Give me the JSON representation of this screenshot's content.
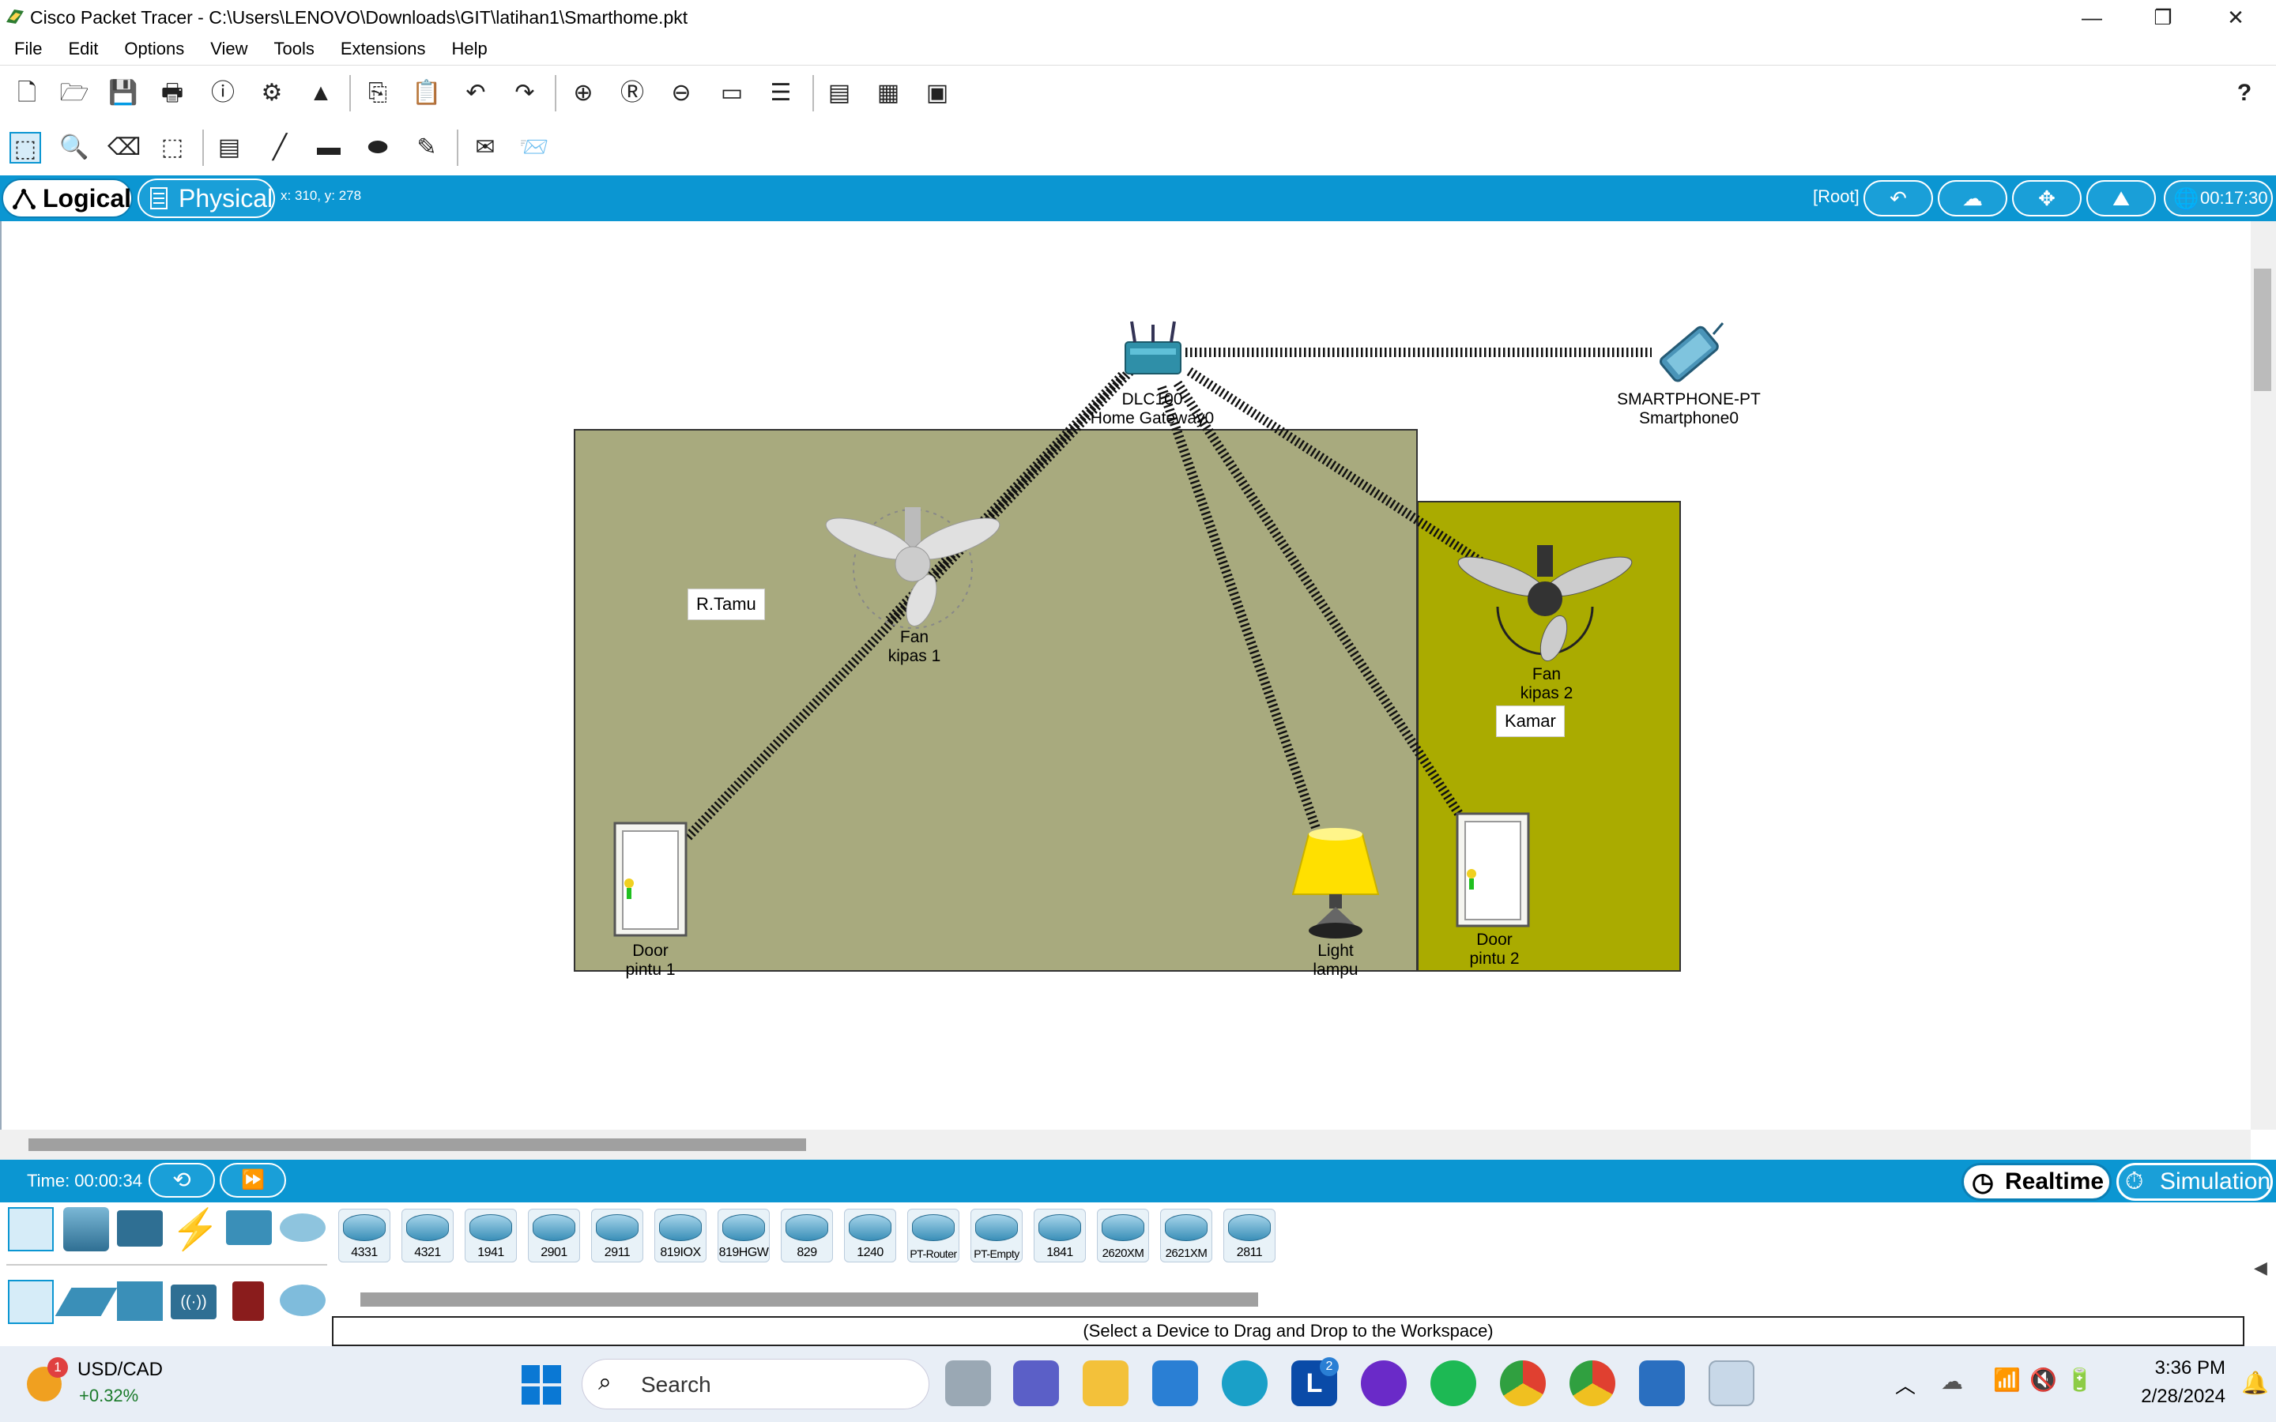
{
  "window": {
    "title": "Cisco Packet Tracer - C:\\Users\\LENOVO\\Downloads\\GIT\\latihan1\\Smarthome.pkt",
    "minimize": "—",
    "restore": "❐",
    "close": "✕"
  },
  "menu": [
    "File",
    "Edit",
    "Options",
    "View",
    "Tools",
    "Extensions",
    "Help"
  ],
  "toolbar_help": "?",
  "modebar": {
    "logical": "Logical",
    "physical": "Physical",
    "coords": "x: 310, y: 278",
    "root": "[Root]",
    "clock": "00:17:30"
  },
  "rooms": [
    {
      "label": "R.Tamu"
    },
    {
      "label": "Kamar"
    }
  ],
  "devices": {
    "gateway": {
      "type": "DLC100",
      "name": "Home Gateway0"
    },
    "smartphone": {
      "type": "SMARTPHONE-PT",
      "name": "Smartphone0"
    },
    "fan1": {
      "type": "Fan",
      "name": "kipas 1"
    },
    "fan2": {
      "type": "Fan",
      "name": "kipas 2"
    },
    "door1": {
      "type": "Door",
      "name": "pintu 1"
    },
    "door2": {
      "type": "Door",
      "name": "pintu 2"
    },
    "light": {
      "type": "Light",
      "name": "lampu"
    }
  },
  "bottombar": {
    "time": "Time: 00:00:34",
    "realtime": "Realtime",
    "simulation": "Simulation"
  },
  "device_models": [
    "4331",
    "4321",
    "1941",
    "2901",
    "2911",
    "819IOX",
    "819HGW",
    "829",
    "1240",
    "PT-Router",
    "PT-Empty",
    "1841",
    "2620XM",
    "2621XM",
    "2811"
  ],
  "hint": "(Select a Device to Drag and Drop to the Workspace)",
  "taskbar": {
    "stock_name": "USD/CAD",
    "stock_change": "+0.32%",
    "stock_badge": "1",
    "search": "Search",
    "time": "3:36 PM",
    "date": "2/28/2024",
    "badge_l": "2"
  },
  "colors": {
    "accent": "#0b96d2",
    "room1": "#a8aa7e",
    "room2": "#aaab00"
  }
}
